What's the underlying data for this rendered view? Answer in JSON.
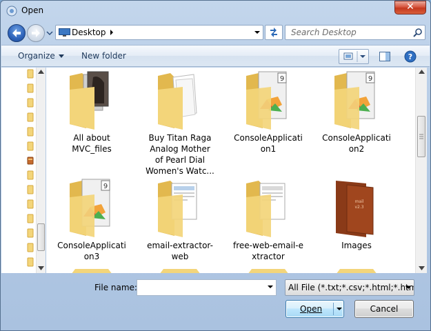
{
  "window": {
    "title": "Open",
    "close_label": "✕"
  },
  "address_bar": {
    "location": "Desktop"
  },
  "search": {
    "placeholder": "Search Desktop"
  },
  "toolbar": {
    "organize_label": "Organize",
    "new_folder_label": "New folder"
  },
  "files": [
    {
      "name": "All about MVC_files",
      "icon": "folder-with-photo-icon"
    },
    {
      "name": "Buy Titan Raga Analog Mother of Pearl Dial Women's Watc...",
      "icon": "folder-with-documents-icon"
    },
    {
      "name": "ConsoleApplication1",
      "icon": "visual-studio-folder-icon"
    },
    {
      "name": "ConsoleApplication2",
      "icon": "visual-studio-folder-icon"
    },
    {
      "name": "ConsoleApplication3",
      "icon": "visual-studio-folder-icon"
    },
    {
      "name": "email-extractor-web",
      "icon": "folder-with-screenshots-icon"
    },
    {
      "name": "free-web-email-extractor",
      "icon": "folder-with-screenshots-icon"
    },
    {
      "name": "Images",
      "icon": "brown-folder-icon"
    }
  ],
  "labels": {
    "f0": "All about\nMVC_files",
    "f1": "Buy Titan Raga\nAnalog Mother\nof Pearl Dial\nWomen's Watc...",
    "f2": "ConsoleApplicati\non1",
    "f3": "ConsoleApplicati\non2",
    "f4": "ConsoleApplicati\non3",
    "f5": "email-extractor-\nweb",
    "f6": "free-web-email-e\nxtractor",
    "f7": "Images"
  },
  "bottom": {
    "file_name_label": "File name:",
    "file_name_value": "",
    "file_type": "All File (*.txt;*.csv;*.html;*.htm;",
    "open_label": "Open",
    "cancel_label": "Cancel"
  },
  "colors": {
    "folder": "#f3d57a",
    "folder_dark": "#e2b84e",
    "accent": "#1e395b"
  }
}
